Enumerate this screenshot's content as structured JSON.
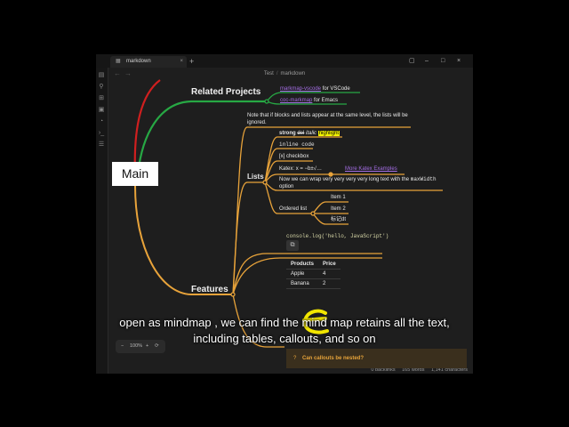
{
  "tab": {
    "label": "markdown",
    "close": "×"
  },
  "new_tab": "+",
  "window_controls": {
    "layout": "▢",
    "minimize": "–",
    "maximize": "□",
    "close": "×"
  },
  "breadcrumb": {
    "parent": "Test",
    "separator": "/",
    "current": "markdown"
  },
  "nav": {
    "back": "←",
    "forward": "→"
  },
  "sidebar_icons": [
    "files-icon",
    "search-icon",
    "graph-icon",
    "calendar-icon",
    "template-icon",
    "terminal-icon",
    "bookmarks-icon"
  ],
  "mindmap": {
    "root": "Main",
    "related_projects": "Related Projects",
    "rp_link1": "markmap-vscode",
    "rp_suffix1": "for VSCode",
    "rp_link2": "coc-markmap",
    "rp_suffix2": "for Emacs",
    "note": "Note that if blocks and lists appear at the same level, the lists will be ignored.",
    "features": "Features",
    "lists": "Lists",
    "strong": "strong",
    "del": "del",
    "italic": "italic",
    "highlight": "highlight",
    "inline_code": "inline code",
    "checkbox": "[x] checkbox",
    "katex": "Katex:",
    "katex_formula": "x = −b±√…",
    "katex_link": "More Katex Examples",
    "long_text_a": "Now we can wrap very very very very long text with the",
    "long_text_code": "maxWidth",
    "long_text_b": "option",
    "ordered_list": "Ordered list",
    "item1": "Item 1",
    "item2": "Item 2",
    "item3": "标记dt",
    "code_line": "console.log('hello, JavaScript')",
    "copy_icon": "⧉",
    "table_headers": [
      "Products",
      "Price"
    ],
    "table_rows": [
      [
        "Apple",
        "4"
      ],
      [
        "Banana",
        "2"
      ]
    ],
    "callout": "Can callouts be nested?",
    "callout_icon": "?"
  },
  "zoom": {
    "minus": "−",
    "value": "100%",
    "plus": "+",
    "reset": "⟳"
  },
  "status": {
    "backlinks": "0 backlinks",
    "words": "165 words",
    "characters": "1,141 characters"
  },
  "caption": {
    "line1": "open as mindmap , we can find the mind map retains all the text,",
    "line2": "including tables, callouts, and so on"
  },
  "colors": {
    "branch_orange": "#e8a33a",
    "branch_red": "#d01f1f",
    "branch_green": "#27a844",
    "link_purple": "#a46ee4",
    "highlight": "#f4f400"
  }
}
